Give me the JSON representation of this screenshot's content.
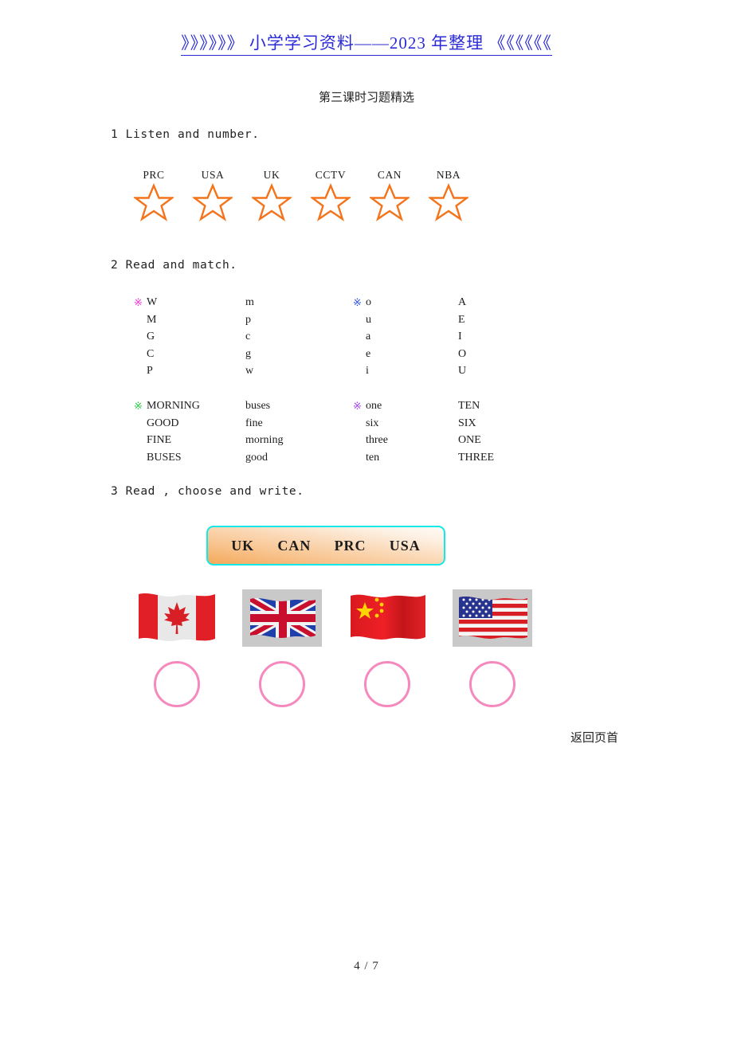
{
  "header": {
    "banner_text": "》》》》》》 小学学习资料——2023 年整理 《《《《《《",
    "banner_color": "#2b2bd6"
  },
  "document": {
    "title": "第三课时习题精选",
    "page_number": "4 / 7",
    "back_to_top": "返回页首"
  },
  "section1": {
    "heading": "1 Listen and number.",
    "star_color": "#f4741b",
    "items": [
      {
        "label": "PRC",
        "icon": "star-outline-icon"
      },
      {
        "label": "USA",
        "icon": "star-outline-icon"
      },
      {
        "label": "UK",
        "icon": "star-outline-icon"
      },
      {
        "label": "CCTV",
        "icon": "star-outline-icon"
      },
      {
        "label": "CAN",
        "icon": "star-outline-icon"
      },
      {
        "label": "NBA",
        "icon": "star-outline-icon"
      }
    ]
  },
  "section2": {
    "heading": "2 Read and match.",
    "bullet_glyph": "※",
    "group1": {
      "bullet_left_color": "#ff2ad4",
      "bullet_right_color": "#2b4bdd",
      "col1": [
        "W",
        "M",
        "G",
        "C",
        "P"
      ],
      "col2": [
        "m",
        "p",
        "c",
        "g",
        "w"
      ],
      "col3": [
        "o",
        "u",
        "a",
        "e",
        "i"
      ],
      "col4": [
        "A",
        "E",
        "I",
        "O",
        "U"
      ]
    },
    "group2": {
      "bullet_left_color": "#22cc44",
      "bullet_right_color": "#a13cf0",
      "col1": [
        "MORNING",
        "GOOD",
        "FINE",
        "BUSES"
      ],
      "col2": [
        "buses",
        "fine",
        "morning",
        "good"
      ],
      "col3": [
        "one",
        "six",
        "three",
        "ten"
      ],
      "col4": [
        "TEN",
        "SIX",
        "ONE",
        "THREE"
      ]
    }
  },
  "section3": {
    "heading": "3 Read , choose and write.",
    "word_bank": {
      "border_color": "#13e8ea",
      "fill_start": "#f3a95a",
      "fill_end": "#fefaf5",
      "words": [
        "UK",
        "CAN",
        "PRC",
        "USA"
      ]
    },
    "flags": [
      {
        "name": "canada-flag",
        "country": "Canada"
      },
      {
        "name": "uk-flag",
        "country": "United Kingdom"
      },
      {
        "name": "china-flag",
        "country": "China"
      },
      {
        "name": "usa-flag",
        "country": "United States"
      }
    ],
    "answer_circles": {
      "count": 4,
      "color": "#f589bd"
    }
  }
}
